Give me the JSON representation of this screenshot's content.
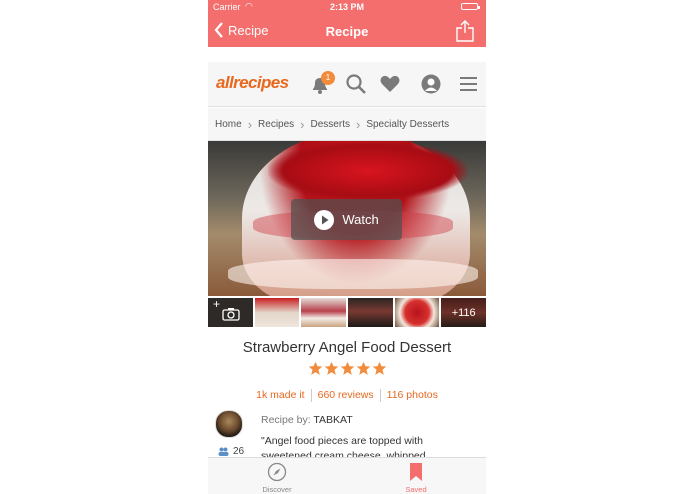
{
  "status_bar": {
    "carrier": "Carrier",
    "time": "2:13 PM"
  },
  "nav": {
    "back_label": "Recipe",
    "title": "Recipe"
  },
  "header": {
    "logo": "allrecipes",
    "notification_count": "1"
  },
  "breadcrumb": [
    "Home",
    "Recipes",
    "Desserts",
    "Specialty Desserts"
  ],
  "hero": {
    "watch_label": "Watch"
  },
  "thumbnails": {
    "more_label": "+116"
  },
  "recipe": {
    "title": "Strawberry Angel Food Dessert",
    "rating": 5,
    "made_it": "1k made it",
    "reviews": "660 reviews",
    "photos": "116 photos",
    "recipe_by_label": "Recipe by: ",
    "author": "TABKAT",
    "followers": "26",
    "description": "\"Angel food pieces are topped with sweetened cream cheese, whipped"
  },
  "tabs": [
    {
      "label": "Discover"
    },
    {
      "label": "Saved"
    }
  ],
  "colors": {
    "nav": "#f46e6e",
    "accent": "#e8681e",
    "star": "#f28b3c"
  }
}
